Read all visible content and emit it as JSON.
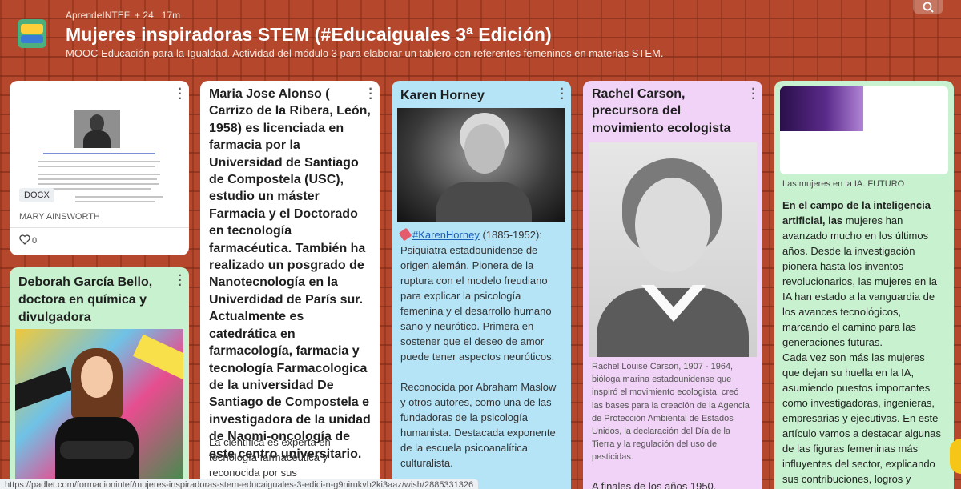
{
  "header": {
    "author": "AprendeINTEF",
    "contributors": "+ 24",
    "time": "17m",
    "title": "Mujeres inspiradoras STEM (#Educaiguales 3ª Edición)",
    "subtitle": "MOOC Educación para la Igualdad. Actividad del módulo 3 para elaborar un tablero con referentes femeninos en materias STEM."
  },
  "cards": {
    "mary": {
      "badge": "DOCX",
      "name": "MARY AINSWORTH",
      "likes": "0"
    },
    "deborah": {
      "title": "Deborah García Bello, doctora en química y divulgadora"
    },
    "maria": {
      "title": "Maria Jose Alonso ( Carrizo de la Ribera, León, 1958) es licenciada en farmacia por la Universidad de Santiago de Compostela (USC), estudio un máster Farmacia y el Doctorado en tecnología farmacéutica. También ha realizado un posgrado de Nanotecnología en la Univerdidad de París   sur. Actualmente es catedrática en farmacología, farmacia y tecnología Farmacologica de la universidad De Santiago de Compostela e investigadora de la unidad de Naomi-oncología de este centro universitario.",
      "body": "La científica es experta en tecnología farmacéutica y reconocida por sus"
    },
    "karen": {
      "title": "Karen Horney",
      "hashtag": "#KarenHorney",
      "body1": " (1885-1952): Psiquiatra estadounidense de origen alemán. Pionera de la ruptura con el modelo freudiano para explicar la psicología femenina y el desarrollo humano sano y neurótico. Primera en sostener que el deseo de amor puede tener aspectos neuróticos.",
      "body2": "Reconocida por Abraham Maslow y otros autores, como una de las fundadoras de la psicología humanista. Destacada exponente de la escuela psicoanalítica culturalista."
    },
    "rachel": {
      "title": "Rachel Carson, precursora del movimiento ecologista",
      "caption": "Rachel Louise Carson, 1907 - 1964, bióloga marina estadounidense que inspiró el movimiento ecologista, creó las bases para la creación de la Agencia de Protección Ambiental de Estados Unidos, la declaración del Día de la Tierra y la regulación del uso de pesticidas.",
      "body": "A finales de los años 1950,"
    },
    "ia": {
      "link_label": "Las mujeres en la IA. FUTURO",
      "bold_intro": "En el campo de la inteligencia artificial, las",
      "body1": " mujeres han avanzado mucho en los últimos años. Desde la investigación pionera hasta los inventos revolucionarios, las mujeres en la IA han estado a la vanguardia de los avances tecnológicos, marcando el camino para las generaciones futuras.",
      "body2": "Cada vez son más las mujeres que dejan su huella en la IA, asumiendo puestos importantes como investigadoras, ingenieras, empresarias y ejecutivas. En este artículo vamos a destacar algunas de las figuras femeninas más influyentes del sector, explicando sus contribuciones, logros y visiones sobre el futuro."
    }
  },
  "statusbar": {
    "url": "https://padlet.com/formacionintef/mujeres-inspiradoras-stem-educaiguales-3-edici-n-g9nirukvh2ki3aaz/wish/2885331326"
  },
  "colors": {
    "card_white": "#ffffff",
    "card_blue": "#b6e4f7",
    "card_pink": "#f1d3f7",
    "card_green": "#c8f2cf"
  }
}
